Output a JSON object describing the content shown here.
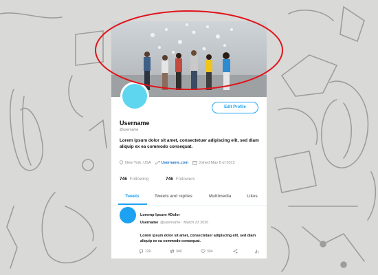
{
  "profile": {
    "edit_button": "Edit Profile",
    "name": "Username",
    "handle": "@username",
    "bio": "Lorem ipsum dolor sit amet, consectetuer adipiscing elit, sed diam aliquip ex ea commodo consequat.",
    "location": "New York, USA",
    "website": "Username.com",
    "joined": "Joined May 8 of 2012",
    "following_count": "746",
    "following_label": "Following",
    "followers_count": "746",
    "followers_label": "Followers"
  },
  "tabs": [
    {
      "label": "Tweets",
      "active": true
    },
    {
      "label": "Tweets and replies",
      "active": false
    },
    {
      "label": "Multimedia",
      "active": false
    },
    {
      "label": "Likes",
      "active": false
    }
  ],
  "tweet": {
    "title": "Loremp Ipsum #Dolor",
    "username": "Username",
    "handle_date": "@username · March 23 2020",
    "body": "Lorem ipsum dolor sit amet, consectetuer adipiscing elit, sed diam aliquip ex ea commodo consequat.",
    "replies": "129",
    "retweets": "349",
    "likes": "334"
  },
  "colors": {
    "accent": "#1da1f2",
    "avatar": "#5fd6f0",
    "annotation": "#e0141b",
    "background": "#d9d9d7"
  },
  "icons": [
    "location-icon",
    "link-icon",
    "calendar-icon",
    "reply-icon",
    "retweet-icon",
    "like-icon",
    "share-icon",
    "stats-icon"
  ]
}
